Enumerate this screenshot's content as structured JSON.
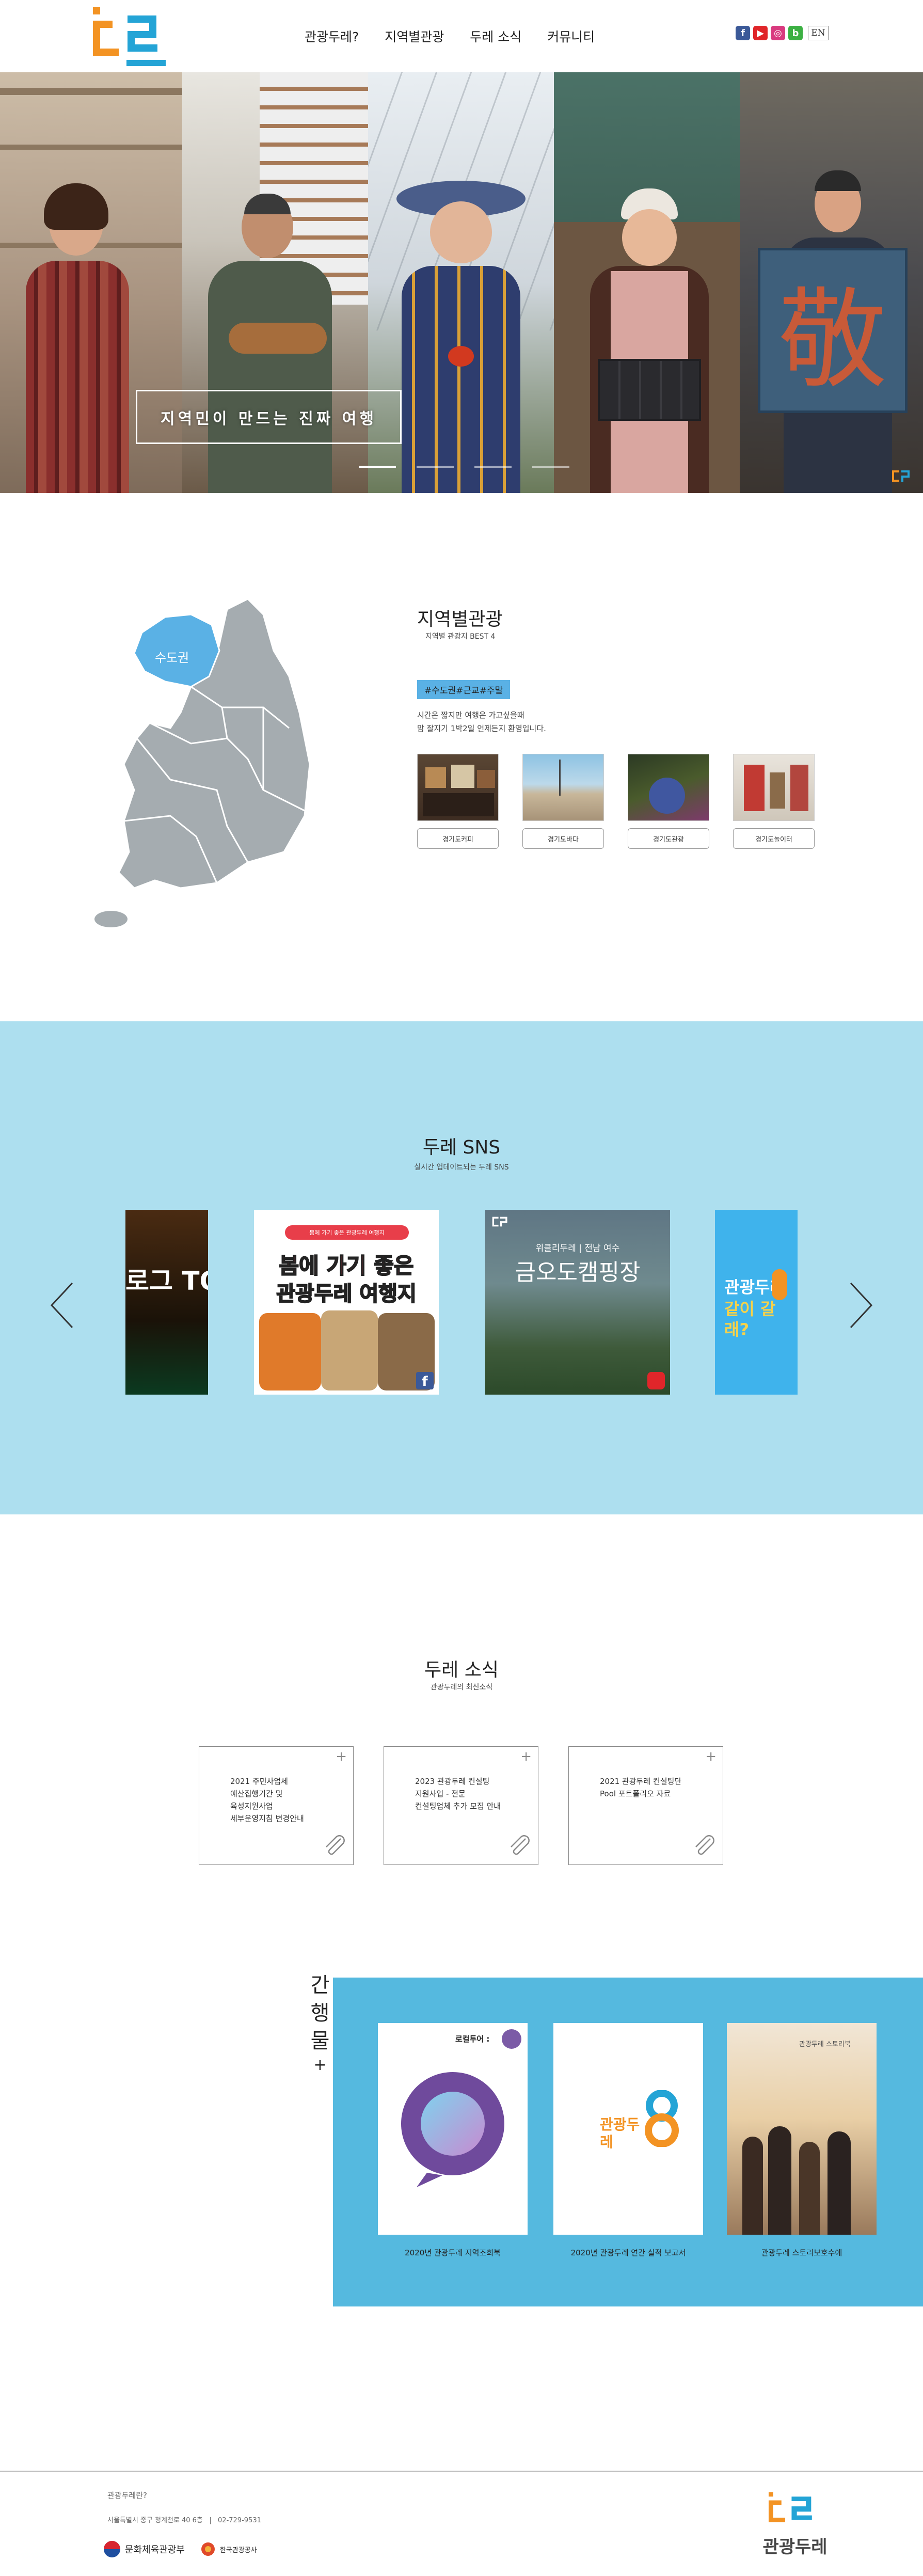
{
  "header": {
    "nav": [
      "관광두레?",
      "지역별관광",
      "두레 소식",
      "커뮤니티"
    ],
    "lang_label": "EN",
    "social_icons": [
      "facebook-icon",
      "youtube-icon",
      "instagram-icon",
      "blog-icon"
    ]
  },
  "hero": {
    "caption": "지역민이 만드는 진짜 여행",
    "slide_count": 4,
    "active_slide": 1
  },
  "regional": {
    "title": "지역별관광",
    "subtitle": "지역별 관광지 BEST 4",
    "map_label": "수도권",
    "tag": "#수도권#근교#주말",
    "desc_line1": "시간은 짧지만 여행은 가고싶을때",
    "desc_line2": "맘 잘지기 1박2일 언제든지 환영입니다.",
    "items": [
      "경기도커피",
      "경기도바다",
      "경기도관광",
      "경기도놀이터"
    ]
  },
  "sns": {
    "title": "두레 SNS",
    "subtitle": "실시간 업데이트되는 두레 SNS",
    "card1_text": "로그 TOP",
    "card2_line1": "봄에 가기 좋은",
    "card2_line2": "관광두레 여행지",
    "card2_banner": "봄에 가기 좋은 관광두레 여행지",
    "card3_small": "위클리두레 | 전남 여수",
    "card3_big": "금오도캠핑장",
    "card4_line1": "관광두레",
    "card4_line2": "같이 갈래?"
  },
  "news": {
    "title": "두레 소식",
    "subtitle": "관광두레의 최신소식",
    "items": [
      {
        "l1": "2021 주민사업체",
        "l2": "예산집행기간 및",
        "l3": "육성지원사업",
        "l4": "세부운영지침 변경안내"
      },
      {
        "l1": "2023 관광두레 컨설팅",
        "l2": "지원사업 - 전문",
        "l3": "컨설팅업체 추가 모집 안내",
        "l4": ""
      },
      {
        "l1": "2021 관광두레 컨설팅단",
        "l2": "Pool 포트폴리오 자료",
        "l3": "",
        "l4": ""
      }
    ]
  },
  "publications": {
    "vertical": [
      "간",
      "행",
      "물"
    ],
    "plus": "+",
    "items": [
      "2020년 관광두레 지역조희북",
      "2020년 관광두레 연간 실적 보고서",
      "관광두레 스토리보호수에"
    ],
    "cover1_title": "로컬투어 :",
    "cover2_title": "관광두레",
    "cover3_title": "관광두레 스토리북"
  },
  "footer": {
    "line1": "관광두레란?",
    "line2": "서울특별시 중구 청계천로 40 6층   |   02-729-9531",
    "ministry": "문화체육관광부",
    "org": "한국관광공사",
    "logo_text": "관광두레"
  },
  "colors": {
    "orange": "#f39323",
    "blue": "#24a4d6",
    "sns_bg": "#addfef",
    "pub_bg": "#55b9df",
    "map": "#a5acb0",
    "map_active": "#5ab1e5"
  }
}
